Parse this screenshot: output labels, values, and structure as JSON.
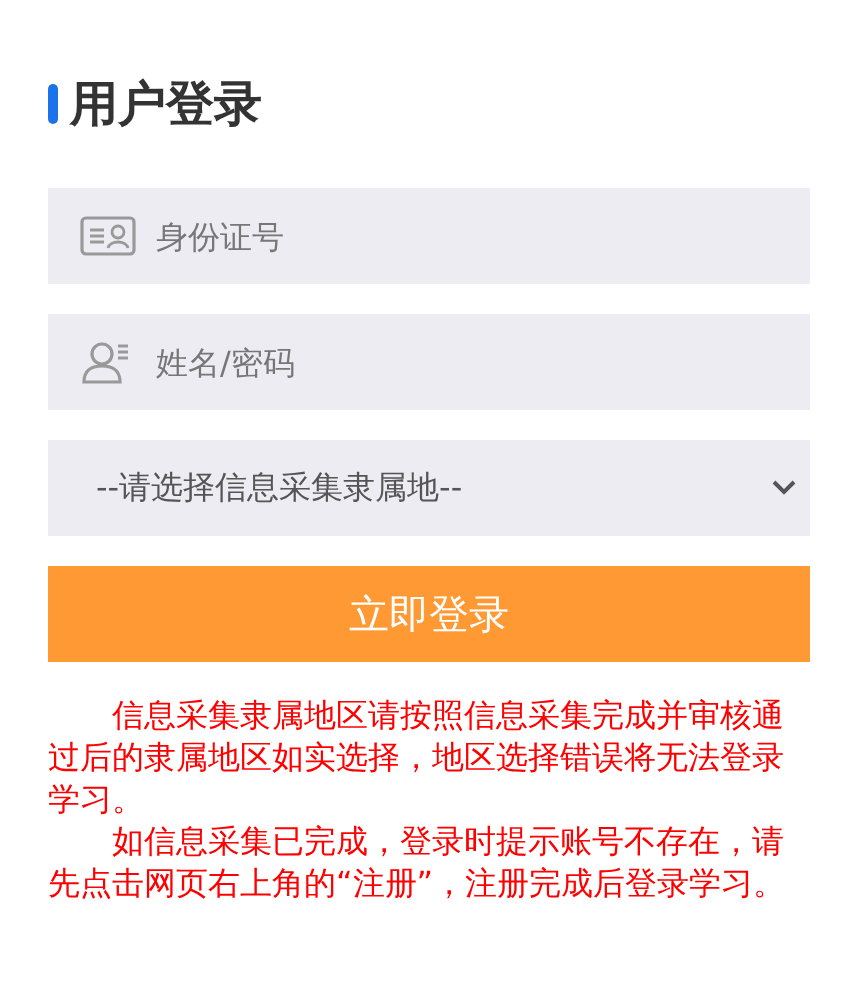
{
  "title": "用户登录",
  "fields": [
    {
      "kind": "id",
      "placeholder": "身份证号"
    },
    {
      "kind": "user",
      "placeholder": "姓名/密码"
    }
  ],
  "region_select": {
    "value": "--请选择信息采集隶属地--"
  },
  "login_button": "立即登录",
  "notes": [
    "信息采集隶属地区请按照信息采集完成并审核通过后的隶属地区如实选择，地区选择错误将无法登录学习。",
    "如信息采集已完成，登录时提示账号不存在，请先点击网页右上角的“注册”，注册完成后登录学习。"
  ]
}
